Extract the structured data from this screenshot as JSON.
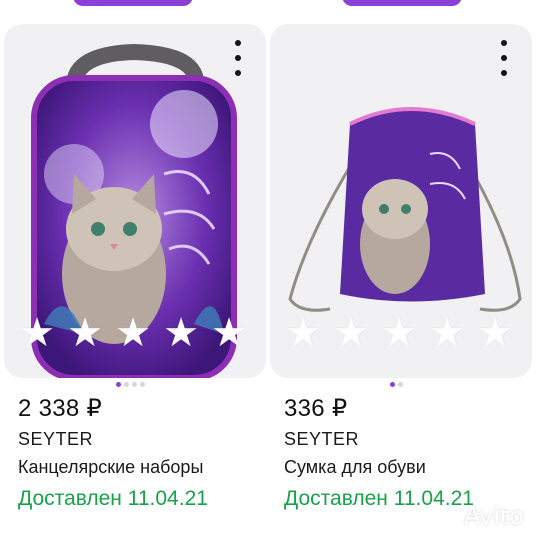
{
  "products": [
    {
      "image_alt": "backpack",
      "price": "2 338 ₽",
      "brand": "SEYTER",
      "title": "Канцелярские наборы",
      "delivery": "Доставлен 11.04.21",
      "rating_stars": 5
    },
    {
      "image_alt": "drawstring bag",
      "price": "336 ₽",
      "brand": "SEYTER",
      "title": "Сумка для обуви",
      "delivery": "Доставлен 11.04.21",
      "rating_stars": 5
    }
  ],
  "watermark": {
    "text": "Avito"
  },
  "icons": {
    "menu": "more-vertical-icon",
    "star": "star-icon"
  },
  "colors": {
    "accent_purple": "#8c3fd6",
    "delivery_green": "#17a34a",
    "star_white": "#ffffff"
  }
}
